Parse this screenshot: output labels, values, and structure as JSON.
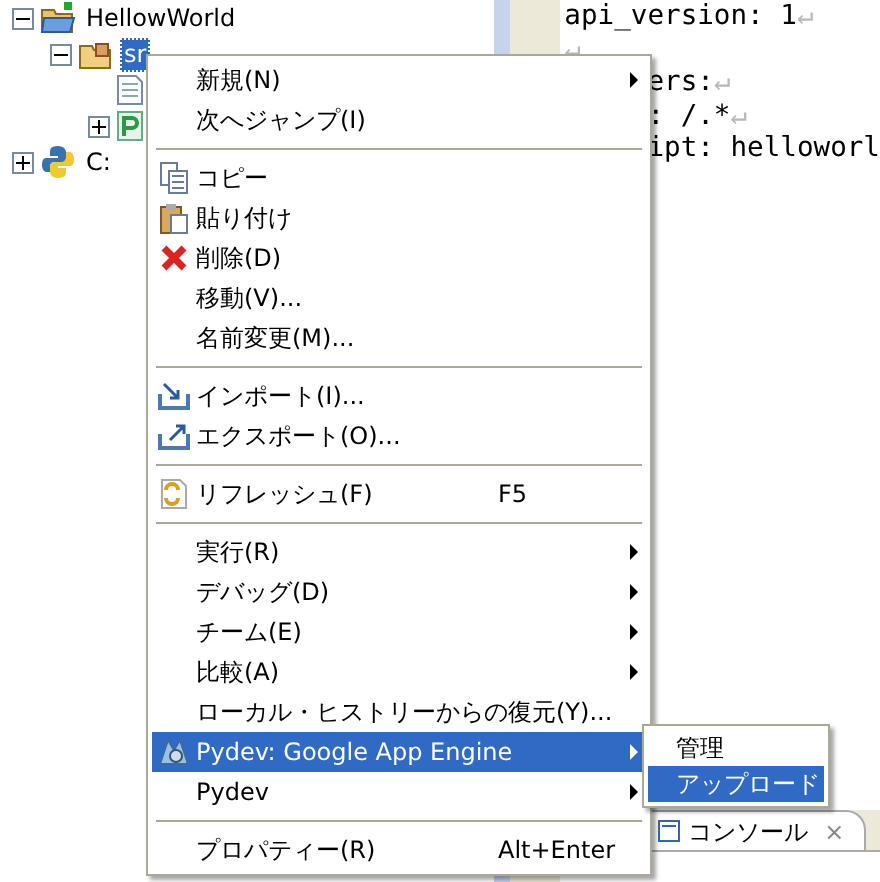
{
  "tree": [
    {
      "label": "HellowWorld",
      "kind": "project",
      "expanded": true,
      "selected": false,
      "children": [
        {
          "label": "sr",
          "kind": "folder",
          "expanded": true,
          "selected": true,
          "children": [
            {
              "kind": "file"
            },
            {
              "kind": "module",
              "expanded": false
            }
          ]
        }
      ]
    },
    {
      "label": "C:",
      "kind": "python",
      "expanded": false,
      "selected": false
    }
  ],
  "editor": {
    "lines": [
      {
        "text": "api_version: 1",
        "end": "↵"
      },
      {
        "end": "↵"
      },
      {
        "text": "ers:",
        "end": "↵"
      },
      {
        "text": ": /.*",
        "end": "↵"
      },
      {
        "text": "ipt: helloworl"
      }
    ]
  },
  "console_tab": {
    "label": "コンソール",
    "close": "×"
  },
  "menu": [
    {
      "kind": "item",
      "label": "新規(N)",
      "submenu": true,
      "selected": false
    },
    {
      "kind": "item",
      "label": "次へジャンプ(I)",
      "submenu": false,
      "selected": false
    },
    {
      "kind": "separator"
    },
    {
      "kind": "item",
      "label": "コピー",
      "submenu": false,
      "selected": false
    },
    {
      "kind": "item",
      "label": "貼り付け",
      "submenu": false,
      "selected": false
    },
    {
      "kind": "item",
      "label": "削除(D)",
      "submenu": false,
      "selected": false
    },
    {
      "kind": "item",
      "label": "移動(V)...",
      "submenu": false,
      "selected": false
    },
    {
      "kind": "item",
      "label": "名前変更(M)...",
      "submenu": false,
      "selected": false
    },
    {
      "kind": "separator"
    },
    {
      "kind": "item",
      "label": "インポート(I)...",
      "submenu": false,
      "selected": false
    },
    {
      "kind": "item",
      "label": "エクスポート(O)...",
      "submenu": false,
      "selected": false
    },
    {
      "kind": "separator"
    },
    {
      "kind": "item",
      "label": "リフレッシュ(F)",
      "shortcut": "F5",
      "submenu": false,
      "selected": false
    },
    {
      "kind": "separator"
    },
    {
      "kind": "item",
      "label": "実行(R)",
      "submenu": true,
      "selected": false
    },
    {
      "kind": "item",
      "label": "デバッグ(D)",
      "submenu": true,
      "selected": false
    },
    {
      "kind": "item",
      "label": "チーム(E)",
      "submenu": true,
      "selected": false
    },
    {
      "kind": "item",
      "label": "比較(A)",
      "submenu": true,
      "selected": false
    },
    {
      "kind": "item",
      "label": "ローカル・ヒストリーからの復元(Y)...",
      "submenu": false,
      "selected": false
    },
    {
      "kind": "item",
      "label": "Pydev: Google App Engine",
      "submenu": true,
      "selected": true
    },
    {
      "kind": "item",
      "label": "Pydev",
      "submenu": true,
      "selected": false
    },
    {
      "kind": "separator"
    },
    {
      "kind": "item",
      "label": "プロパティー(R)",
      "shortcut": "Alt+Enter",
      "submenu": false,
      "selected": false
    }
  ],
  "submenu": [
    {
      "label": "管理",
      "selected": false
    },
    {
      "label": "アップロード",
      "selected": true
    }
  ]
}
